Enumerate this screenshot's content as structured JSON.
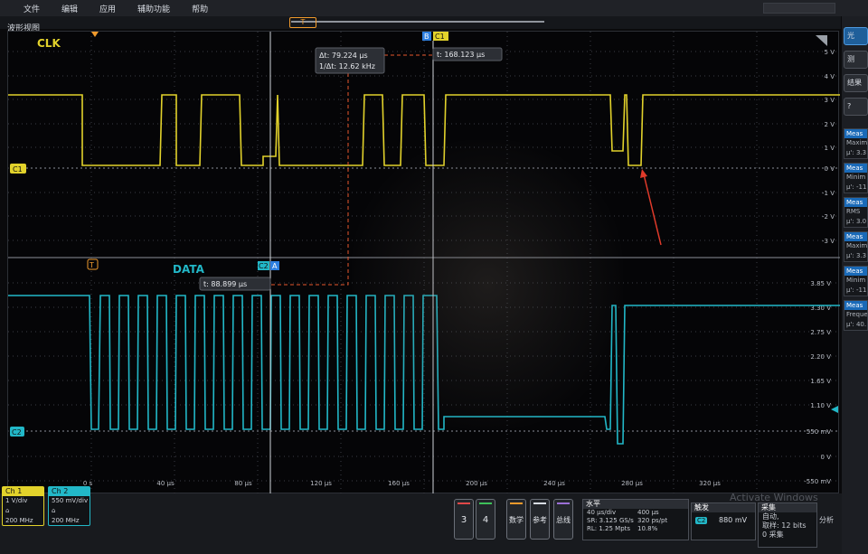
{
  "menu": [
    "文件",
    "编辑",
    "应用",
    "辅助功能",
    "帮助"
  ],
  "panel_title": "波形视图",
  "trigger_marker_label": "T",
  "channels": {
    "clk_label": "CLK",
    "data_label": "DATA",
    "c1_badge": "C1",
    "c2_badge": "C2",
    "cursor_a": "A",
    "cursor_b": "B",
    "colors": {
      "ch1": "#e2d22b",
      "ch2": "#22b8c8",
      "cursor": "#e8562e",
      "trigger": "#f09a2c"
    }
  },
  "cursors": {
    "delta": "Δt: 79.224 μs",
    "inv_delta": "1/Δt: 12.62 kHz",
    "cursor_b_time": "t: 168.123 μs",
    "cursor_a_time": "t: 88.899 μs"
  },
  "ch1_scale": [
    "5 V",
    "4 V",
    "3 V",
    "2 V",
    "1 V",
    "0 V",
    "-1 V",
    "-2 V",
    "-3 V"
  ],
  "ch2_scale": [
    "3.85 V",
    "3.30 V",
    "2.75 V",
    "2.20 V",
    "1.65 V",
    "1.10 V",
    "550 mV",
    "0 V",
    "-550 mV"
  ],
  "time_ticks": [
    "0 s",
    "40 μs",
    "80 μs",
    "120 μs",
    "160 μs",
    "200 μs",
    "240 μs",
    "280 μs",
    "320 μs"
  ],
  "ch1_box": {
    "header": "Ch 1",
    "scale": "1 V/div",
    "bw": "200 MHz"
  },
  "ch2_box": {
    "header": "Ch 2",
    "scale": "550 mV/div",
    "bw": "200 MHz"
  },
  "buttons": {
    "ch3": "3",
    "ch4": "4",
    "math": "数学",
    "ref": "参考",
    "bus": "总线"
  },
  "horizontal": {
    "header": "水平",
    "scale": "40 μs/div",
    "position": "400 μs",
    "sample_rate": "SR: 3.125 GS/s",
    "resolution": "320 ps/pt",
    "record_length": "RL: 1.25 Mpts",
    "percent": "10.8%"
  },
  "trigger": {
    "header": "触发",
    "source": "C2",
    "level": "880 mV"
  },
  "acquisition": {
    "header": "采集",
    "mode": "自动,",
    "type": "取样: 12 bits",
    "count": "0 采集"
  },
  "analyze_label": "分析",
  "right_buttons": [
    "光",
    "测",
    "结果",
    "?"
  ],
  "measurements": [
    {
      "header": "Meas",
      "line1": "Maxim",
      "line2": "μ': 3.3"
    },
    {
      "header": "Meas",
      "line1": "Minim",
      "line2": "μ': -11"
    },
    {
      "header": "Meas",
      "line1": "RMS",
      "line2": "μ': 3.0"
    },
    {
      "header": "Meas",
      "line1": "Maxim",
      "line2": "μ': 3.3"
    },
    {
      "header": "Meas",
      "line1": "Minim",
      "line2": "μ': -11"
    },
    {
      "header": "Meas",
      "line1": "Freque",
      "line2": "μ': 40."
    }
  ],
  "watermark": "Activate Windows"
}
